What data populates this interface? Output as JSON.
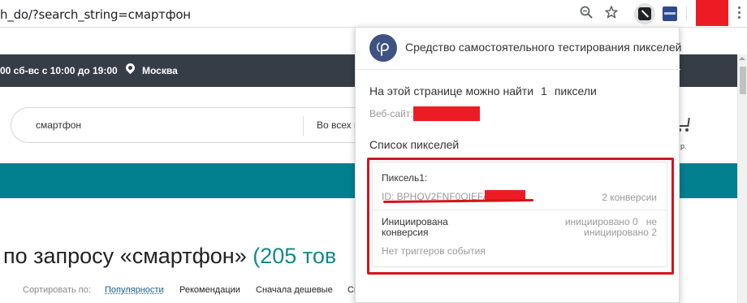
{
  "browser": {
    "url": "h_do/?search_string=смартфон",
    "zoom_icon": "zoom-icon",
    "bookmark_icon": "star-icon",
    "active_extension_icon": "pixel-helper-icon",
    "second_extension_icon": "extension-icon",
    "menu_icon": "kebab-menu-icon",
    "profile_color": "#ed1c24"
  },
  "site": {
    "hours": "00 сб-вс с 10:00 до 19:00",
    "city": "Москва",
    "search_value": "смартфон",
    "category": "Во всех к",
    "cart_label": "р.",
    "results_title_prefix": "по запросу «смартфон»",
    "results_count": "(205 тов",
    "sort_label": "Сортировать по:",
    "sort_options": [
      "Популярности",
      "Рекомендации",
      "Сначала дешевые",
      "Сн"
    ],
    "accent_color": "#028090",
    "topbar_color": "#373d47"
  },
  "popup": {
    "title": "Средство самостоятельного тестирования пикселей",
    "found_prefix": "На этой странице можно найти",
    "found_count": "1",
    "found_suffix": "пиксели",
    "website_label": "Веб-сайт:",
    "list_title": "Список пикселей",
    "pixel": {
      "name": "Пиксель1:",
      "id": "ID: BPHQV2FNF0QIEFA",
      "conversions": "2 конверсии",
      "initiated_label_1": "Инициирована",
      "initiated_label_2": "конверсия",
      "initiated_value_1": "инициировано 0   не",
      "initiated_value_2": "инициировано 2",
      "no_triggers": "Нет триггеров события"
    },
    "logo_color": "#3f5382",
    "highlight_color": "#d6131b"
  }
}
